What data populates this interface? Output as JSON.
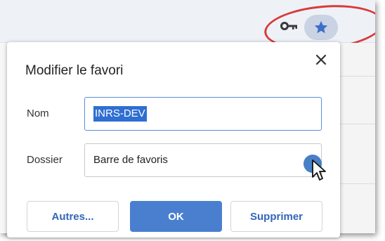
{
  "toolbar": {
    "icons": [
      "key-icon",
      "star-icon"
    ],
    "highlight_color": "#d83a3a"
  },
  "dialog": {
    "title": "Modifier le favori",
    "close_icon": "close-icon",
    "name_label": "Nom",
    "name_value": "INRS-DEV",
    "folder_label": "Dossier",
    "folder_value": "Barre de favoris",
    "buttons": {
      "other": "Autres...",
      "ok": "OK",
      "delete": "Supprimer"
    }
  },
  "colors": {
    "accent": "#4a7fd0",
    "star_bg": "#c9d3e3",
    "selection": "#2f6ed2"
  }
}
